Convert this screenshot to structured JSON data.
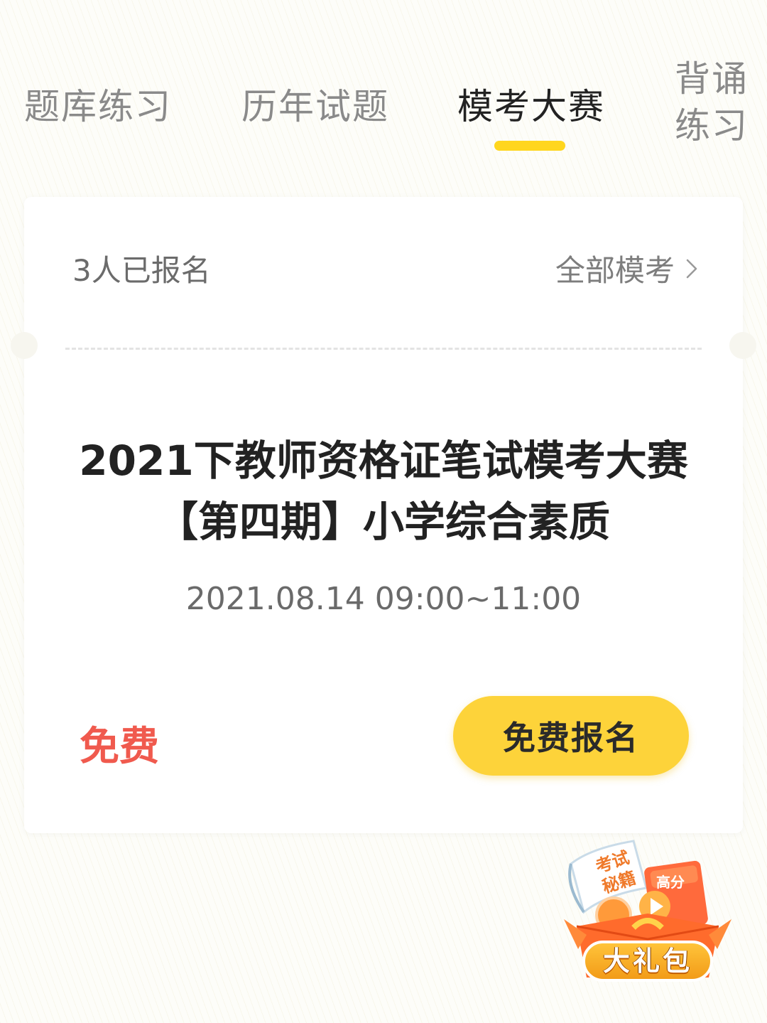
{
  "tabs": [
    {
      "label": "题库练习",
      "active": false
    },
    {
      "label": "历年试题",
      "active": false
    },
    {
      "label": "模考大赛",
      "active": true
    },
    {
      "label": "背诵练习",
      "active": false
    }
  ],
  "card": {
    "enroll_count": "3人已报名",
    "all_exams_link": "全部模考",
    "title": "2021下教师资格证笔试模考大赛【第四期】小学综合素质",
    "time": "2021.08.14 09:00~11:00",
    "price": "免费",
    "signup_button": "免费报名"
  },
  "gift_pack": {
    "label": "大礼包",
    "book_text": "考试秘籍",
    "badge_text": "高分"
  },
  "colors": {
    "accent": "#ffd61e",
    "button": "#fdd33a",
    "price": "#f05a4e"
  }
}
